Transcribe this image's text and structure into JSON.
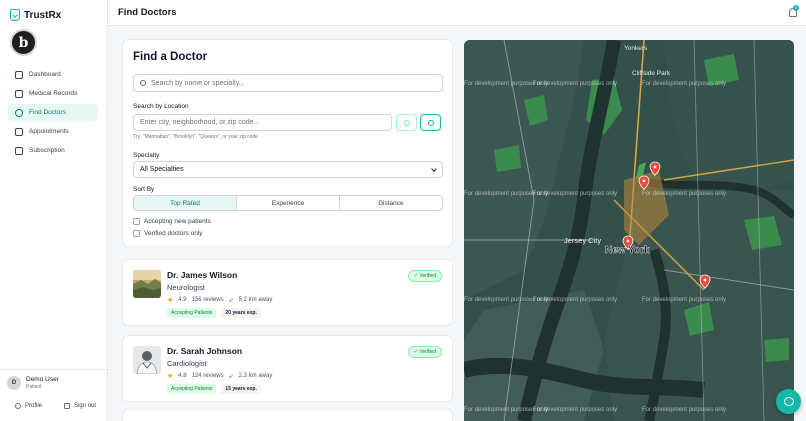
{
  "app": {
    "name": "TrustRx"
  },
  "sidebar": {
    "items": [
      {
        "label": "Dashboard",
        "icon": "home-icon"
      },
      {
        "label": "Medical Records",
        "icon": "file-icon"
      },
      {
        "label": "Find Doctors",
        "icon": "user-icon",
        "active": true
      },
      {
        "label": "Appointments",
        "icon": "calendar-icon"
      },
      {
        "label": "Subscription",
        "icon": "credit-card-icon"
      }
    ],
    "user": {
      "initial": "D",
      "name": "Demo User",
      "role": "Patient"
    },
    "profile_label": "Profile",
    "signout_label": "Sign out"
  },
  "header": {
    "title": "Find Doctors",
    "notification_count": "2"
  },
  "search": {
    "title": "Find a Doctor",
    "placeholder": "Search by name or specialty...",
    "location_label": "Search by Location",
    "location_placeholder": "Enter city, neighborhood, or zip code...",
    "location_hint": "Try: \"Manhattan\", \"Brooklyn\", \"Queens\", or your zip code",
    "specialty_label": "Specialty",
    "specialty_value": "All Specialties",
    "sort_label": "Sort By",
    "sort_options": [
      "Top Rated",
      "Experience",
      "Distance"
    ],
    "sort_active": "Top Rated",
    "filter_accepting": "Accepting new patients",
    "filter_verified": "Verified doctors only"
  },
  "doctors": [
    {
      "name": "Dr. James Wilson",
      "specialty": "Neurologist",
      "rating": "4.9",
      "reviews": "156 reviews",
      "distance": "5.2 km away",
      "status": "Accepting Patients",
      "experience": "20 years exp.",
      "badge": "✓ Verified"
    },
    {
      "name": "Dr. Sarah Johnson",
      "specialty": "Cardiologist",
      "rating": "4.8",
      "reviews": "124 reviews",
      "distance": "2.3 km away",
      "status": "Accepting Patients",
      "experience": "15 years exp.",
      "badge": "✓ Verified"
    }
  ],
  "map": {
    "watermark": "For development purposes only",
    "labels": {
      "yonkers": "Yonkers",
      "clifside": "Cliffside Park",
      "jersey": "Jersey City",
      "newyork": "New York"
    }
  },
  "colors": {
    "accent": "#14b8a6",
    "verified": "#15803d",
    "pin": "#e74c3c"
  }
}
